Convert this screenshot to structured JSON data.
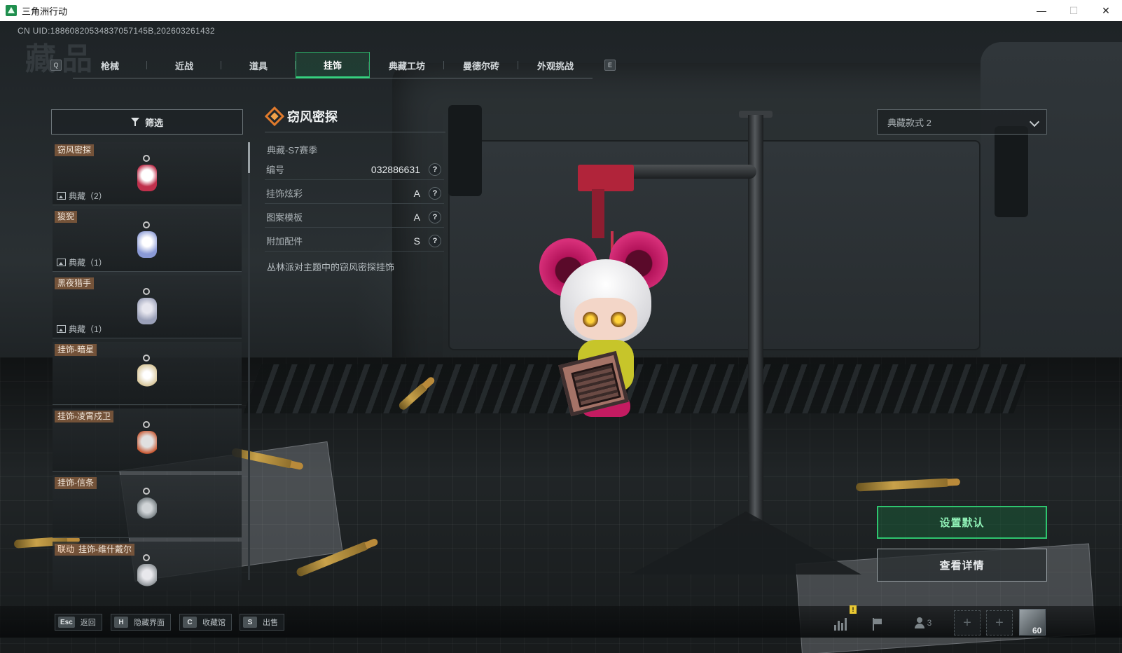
{
  "window": {
    "title": "三角洲行动",
    "minimize": "—",
    "maximize": "☐",
    "close": "✕"
  },
  "header": {
    "uid": "CN UID:18860820534837057145B,202603261432",
    "page_watermark": "藏品",
    "key_prev": "Q",
    "key_next": "E",
    "tabs": [
      {
        "label": "枪械",
        "active": false
      },
      {
        "label": "近战",
        "active": false
      },
      {
        "label": "道具",
        "active": false
      },
      {
        "label": "挂饰",
        "active": true
      },
      {
        "label": "典藏工坊",
        "active": false
      },
      {
        "label": "曼德尔砖",
        "active": false
      },
      {
        "label": "外观挑战",
        "active": false
      }
    ]
  },
  "sidebar": {
    "filter_label": "筛选",
    "items": [
      {
        "name": "窃风密探",
        "count": "典藏（2）",
        "color": "#c0304c"
      },
      {
        "name": "狻猊",
        "count": "典藏（1）",
        "color": "#8a9ad6"
      },
      {
        "name": "黑夜猎手",
        "count": "典藏（1）",
        "color": "#9aa0b8"
      },
      {
        "name": "挂饰-暗星",
        "count": "",
        "color": "#d8c69a"
      },
      {
        "name": "挂饰-凌霄戍卫",
        "count": "",
        "color": "#e0e0e0"
      },
      {
        "name": "挂饰-信条",
        "count": "",
        "color": "#cfd3d6"
      },
      {
        "name": "挂饰-维什戴尔",
        "collab": "联动",
        "count": "",
        "color": "#e8e8ec"
      }
    ]
  },
  "detail": {
    "name": "窃风密探",
    "season": "典藏-S7赛季",
    "properties": [
      {
        "label": "编号",
        "value": "032886631"
      },
      {
        "label": "挂饰炫彩",
        "value": "A"
      },
      {
        "label": "图案模板",
        "value": "A"
      },
      {
        "label": "附加配件",
        "value": "S"
      }
    ],
    "help_glyph": "?",
    "description": "丛林派对主题中的窃风密探挂饰"
  },
  "right": {
    "style_select": "典藏款式 2",
    "set_default": "设置默认",
    "view_detail": "查看详情"
  },
  "bottom": {
    "hints": [
      {
        "key": "Esc",
        "label": "返回"
      },
      {
        "key": "H",
        "label": "隐藏界面"
      },
      {
        "key": "C",
        "label": "收藏馆"
      },
      {
        "key": "S",
        "label": "出售"
      }
    ],
    "friends_count": "3",
    "warn_glyph": "!",
    "add_glyph": "+",
    "level": "60"
  }
}
